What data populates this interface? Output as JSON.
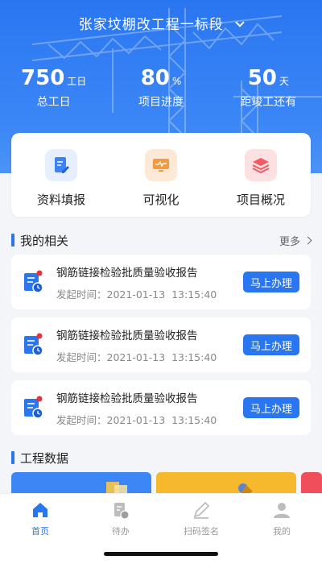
{
  "header": {
    "project_name": "张家坟棚改工程一标段",
    "stats": [
      {
        "value": "750",
        "unit": "工日",
        "label": "总工日"
      },
      {
        "value": "80",
        "unit": "%",
        "label": "项目进度"
      },
      {
        "value": "50",
        "unit": "天",
        "label": "距竣工还有"
      }
    ]
  },
  "quick": [
    {
      "label": "资料填报",
      "icon": "document-edit-icon",
      "color": "#2a76f1"
    },
    {
      "label": "可视化",
      "icon": "monitor-icon",
      "color": "#f08a2b"
    },
    {
      "label": "项目概况",
      "icon": "layers-icon",
      "color": "#ef4e5a"
    }
  ],
  "related": {
    "title": "我的相关",
    "more": "更多",
    "tasks": [
      {
        "title": "钢筋链接检验批质量验收报告",
        "time_label": "发起时间：",
        "time": "2021-01-13  13:15:40",
        "action": "马上办理"
      },
      {
        "title": "钢筋链接检验批质量验收报告",
        "time_label": "发起时间：",
        "time": "2021-01-13  13:15:40",
        "action": "马上办理"
      },
      {
        "title": "钢筋链接检验批质量验收报告",
        "time_label": "发起时间：",
        "time": "2021-01-13  13:15:40",
        "action": "马上办理"
      }
    ]
  },
  "engineering": {
    "title": "工程数据"
  },
  "tabs": [
    {
      "label": "首页",
      "icon": "home-icon",
      "active": true
    },
    {
      "label": "待办",
      "icon": "todo-icon",
      "active": false
    },
    {
      "label": "扫码签名",
      "icon": "sign-icon",
      "active": false
    },
    {
      "label": "我的",
      "icon": "user-icon",
      "active": false
    }
  ],
  "colors": {
    "accent": "#2a76f1"
  }
}
